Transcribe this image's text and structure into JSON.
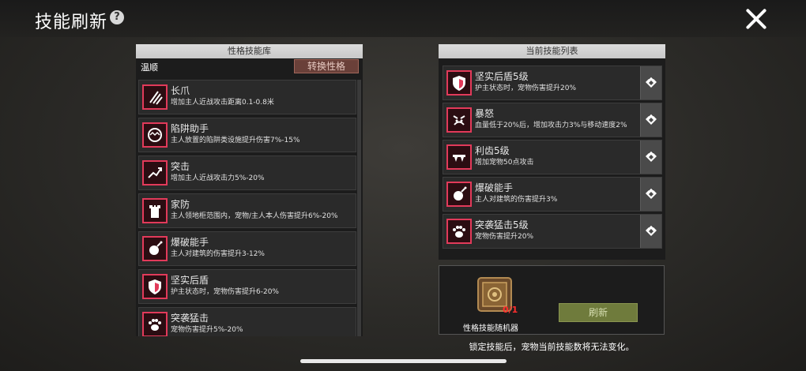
{
  "window": {
    "title": "技能刷新"
  },
  "icons": {
    "help": "question-circle-icon",
    "close": "close-x-icon"
  },
  "colors": {
    "icon_accent": "#e23a5a",
    "switch_button": "#6a4039",
    "refresh_button": "#6f7b3c",
    "item_count": "#ff2e2e"
  },
  "library": {
    "header": "性格技能库",
    "personality": "温顺",
    "switch_label": "转换性格",
    "skills": [
      {
        "name": "长爪",
        "desc": "增加主人近战攻击距离0.1-0.8米",
        "icon": "claw-icon"
      },
      {
        "name": "陷阱助手",
        "desc": "主人放置的陷阱类设施提升伤害7%-15%",
        "icon": "trap-icon"
      },
      {
        "name": "突击",
        "desc": "增加主人近战攻击力5%-20%",
        "icon": "charge-icon"
      },
      {
        "name": "家防",
        "desc": "主人领地柜范围内，宠物/主人本人伤害提升6%-20%",
        "icon": "tower-icon"
      },
      {
        "name": "爆破能手",
        "desc": "主人对建筑的伤害提升3-12%",
        "icon": "bomb-icon"
      },
      {
        "name": "坚实后盾",
        "desc": "护主状态时，宠物伤害提升6-20%",
        "icon": "shield-icon"
      },
      {
        "name": "突袭猛击",
        "desc": "宠物伤害提升5%-20%",
        "icon": "paw-icon"
      }
    ]
  },
  "current": {
    "header": "当前技能列表",
    "skills": [
      {
        "name": "坚实后盾5级",
        "desc": "护主状态时，宠物伤害提升20%",
        "icon": "shield-icon"
      },
      {
        "name": "暴怒",
        "desc": "血量低于20%后，增加攻击力3%与移动速度2%",
        "icon": "rage-icon"
      },
      {
        "name": "利齿5级",
        "desc": "增加宠物50点攻击",
        "icon": "fang-icon"
      },
      {
        "name": "爆破能手",
        "desc": "主人对建筑的伤害提升3%",
        "icon": "bomb-icon"
      },
      {
        "name": "突袭猛击5级",
        "desc": "宠物伤害提升20%",
        "icon": "paw-icon"
      }
    ]
  },
  "refresh": {
    "item_label": "性格技能随机器",
    "item_count": "0/1",
    "button_label": "刷新",
    "notice": "锁定技能后，宠物当前技能数将无法变化。"
  }
}
